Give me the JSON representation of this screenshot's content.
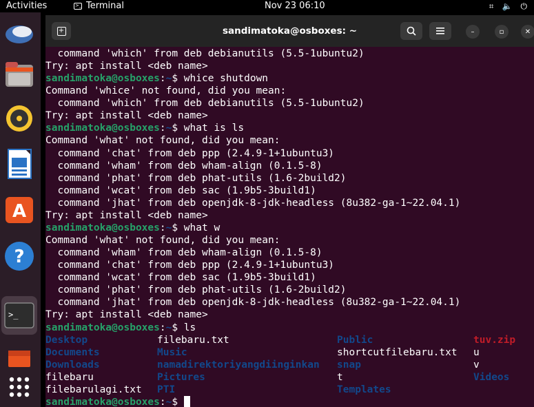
{
  "topbar": {
    "activities": "Activities",
    "app_name": "Terminal",
    "clock": "Nov 23  06:10"
  },
  "window": {
    "title": "sandimatoka@osboxes: ~"
  },
  "dock": {
    "items": [
      "thunderbird-icon",
      "files-icon",
      "rhythmbox-icon",
      "writer-icon",
      "app-center-icon",
      "help-icon",
      "terminal-icon",
      "software-icon",
      "app-grid-icon"
    ]
  },
  "prompt": {
    "user": "sandimatoka@osboxes",
    "sep": ":",
    "path": "~",
    "sym": "$"
  },
  "lines": [
    {
      "type": "out",
      "text": "  command 'which' from deb debianutils (5.5-1ubuntu2)"
    },
    {
      "type": "out",
      "text": "Try: apt install <deb name>"
    },
    {
      "type": "prompt",
      "cmd": " whice shutdown"
    },
    {
      "type": "out",
      "text": "Command 'whice' not found, did you mean:"
    },
    {
      "type": "out",
      "text": "  command 'which' from deb debianutils (5.5-1ubuntu2)"
    },
    {
      "type": "out",
      "text": "Try: apt install <deb name>"
    },
    {
      "type": "prompt",
      "cmd": " what is ls"
    },
    {
      "type": "out",
      "text": "Command 'what' not found, did you mean:"
    },
    {
      "type": "out",
      "text": "  command 'chat' from deb ppp (2.4.9-1+1ubuntu3)"
    },
    {
      "type": "out",
      "text": "  command 'wham' from deb wham-align (0.1.5-8)"
    },
    {
      "type": "out",
      "text": "  command 'phat' from deb phat-utils (1.6-2build2)"
    },
    {
      "type": "out",
      "text": "  command 'wcat' from deb sac (1.9b5-3build1)"
    },
    {
      "type": "out",
      "text": "  command 'jhat' from deb openjdk-8-jdk-headless (8u382-ga-1~22.04.1)"
    },
    {
      "type": "out",
      "text": "Try: apt install <deb name>"
    },
    {
      "type": "prompt",
      "cmd": " what w"
    },
    {
      "type": "out",
      "text": "Command 'what' not found, did you mean:"
    },
    {
      "type": "out",
      "text": "  command 'wham' from deb wham-align (0.1.5-8)"
    },
    {
      "type": "out",
      "text": "  command 'chat' from deb ppp (2.4.9-1+1ubuntu3)"
    },
    {
      "type": "out",
      "text": "  command 'wcat' from deb sac (1.9b5-3build1)"
    },
    {
      "type": "out",
      "text": "  command 'phat' from deb phat-utils (1.6-2build2)"
    },
    {
      "type": "out",
      "text": "  command 'jhat' from deb openjdk-8-jdk-headless (8u382-ga-1~22.04.1)"
    },
    {
      "type": "out",
      "text": "Try: apt install <deb name>"
    },
    {
      "type": "prompt",
      "cmd": " ls"
    },
    {
      "type": "ls",
      "cells": [
        {
          "t": "Desktop",
          "k": "dir"
        },
        {
          "t": "filebaru.txt",
          "k": "file"
        },
        {
          "t": "Public",
          "k": "dir"
        },
        {
          "t": "tuv.zip",
          "k": "zip"
        }
      ]
    },
    {
      "type": "ls",
      "cells": [
        {
          "t": "Documents",
          "k": "dir"
        },
        {
          "t": "Music",
          "k": "dir"
        },
        {
          "t": "shortcutfilebaru.txt",
          "k": "file"
        },
        {
          "t": "u",
          "k": "file"
        }
      ]
    },
    {
      "type": "ls",
      "cells": [
        {
          "t": "Downloads",
          "k": "dir"
        },
        {
          "t": "namadirektoriyangdiinginkan",
          "k": "dir"
        },
        {
          "t": "snap",
          "k": "dir"
        },
        {
          "t": "v",
          "k": "file"
        }
      ]
    },
    {
      "type": "ls",
      "cells": [
        {
          "t": "filebaru",
          "k": "file"
        },
        {
          "t": "Pictures",
          "k": "dir"
        },
        {
          "t": "t",
          "k": "file"
        },
        {
          "t": "Videos",
          "k": "dir"
        }
      ]
    },
    {
      "type": "ls",
      "cells": [
        {
          "t": "filebarulagi.txt",
          "k": "file"
        },
        {
          "t": "PTI",
          "k": "dir"
        },
        {
          "t": "Templates",
          "k": "dir"
        },
        {
          "t": "",
          "k": "file"
        }
      ]
    },
    {
      "type": "prompt",
      "cmd": " ",
      "cursor": true
    }
  ]
}
